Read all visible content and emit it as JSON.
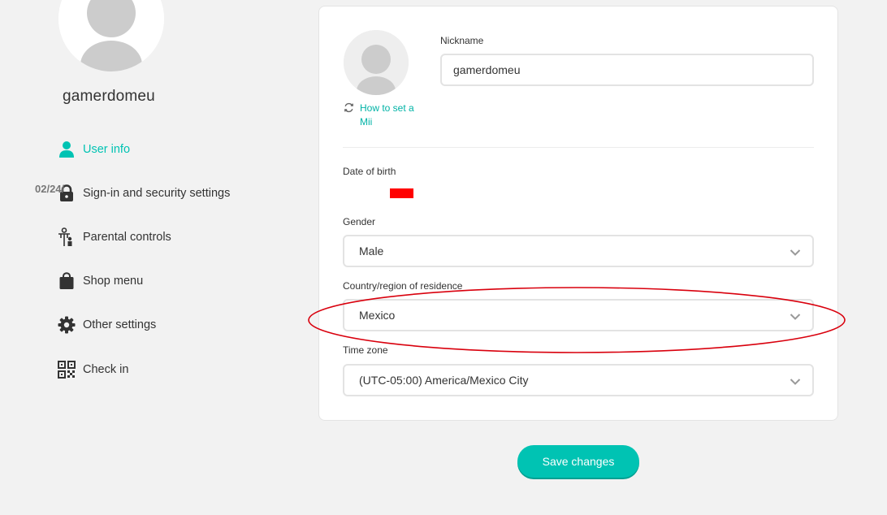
{
  "sidebar": {
    "username": "gamerdomeu",
    "items": [
      {
        "label": "User info",
        "icon": "person-icon",
        "active": true
      },
      {
        "label": "Sign-in and security settings",
        "icon": "lock-icon",
        "active": false
      },
      {
        "label": "Parental controls",
        "icon": "parental-controls-icon",
        "active": false
      },
      {
        "label": "Shop menu",
        "icon": "shopping-bag-icon",
        "active": false
      },
      {
        "label": "Other settings",
        "icon": "gear-icon",
        "active": false
      },
      {
        "label": "Check in",
        "icon": "qr-code-icon",
        "active": false
      }
    ]
  },
  "profile": {
    "mii_link": "How to set a Mii",
    "nickname_label": "Nickname",
    "nickname_value": "gamerdomeu",
    "dob_label": "Date of birth",
    "dob_value": "02/24/",
    "gender_label": "Gender",
    "gender_value": "Male",
    "country_label": "Country/region of residence",
    "country_value": "Mexico",
    "timezone_label": "Time zone",
    "timezone_value": "(UTC-05:00) America/Mexico City"
  },
  "actions": {
    "save_label": "Save changes"
  },
  "colors": {
    "accent": "#00c3b3",
    "annotation": "#d9000d",
    "redaction": "#ff0000"
  }
}
